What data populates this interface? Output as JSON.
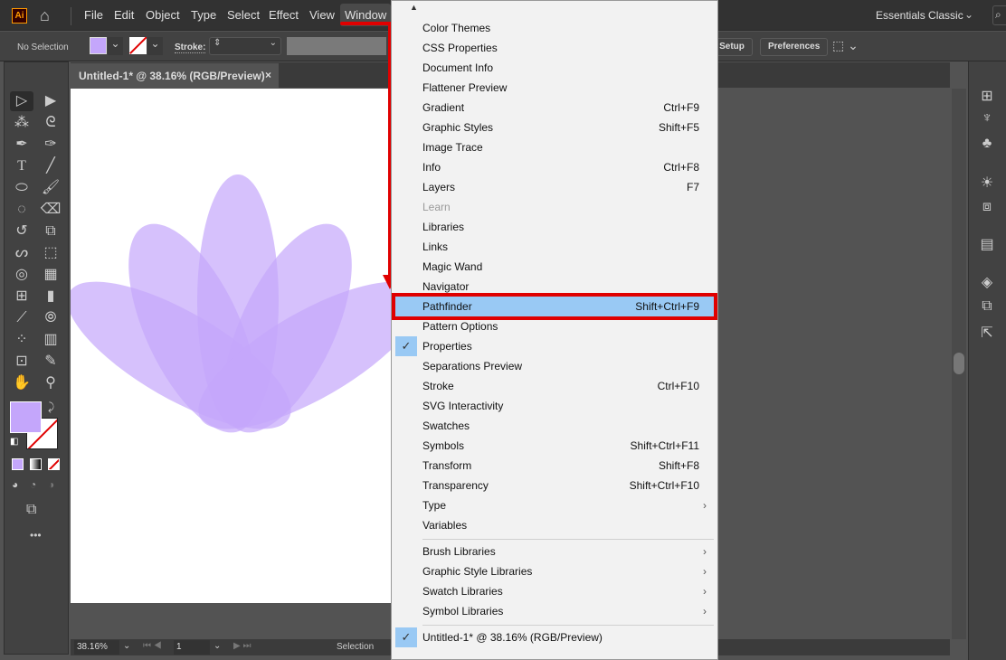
{
  "app": {
    "logo": "Ai",
    "menus": [
      "File",
      "Edit",
      "Object",
      "Type",
      "Select",
      "Effect",
      "View",
      "Window"
    ],
    "workspace": "Essentials Classic"
  },
  "control": {
    "selection": "No Selection",
    "stroke_label": "Stroke:",
    "doc_setup": "t Setup",
    "preferences": "Preferences"
  },
  "doc": {
    "tab_title": "Untitled-1* @ 38.16% (RGB/Preview)",
    "close": "×"
  },
  "status": {
    "zoom": "38.16%",
    "artboard": "1",
    "tool": "Selection"
  },
  "colors": {
    "fill": "#c4a6fb",
    "accent_red": "#e00000",
    "highlight": "#99c9f4"
  },
  "window_menu": {
    "items": [
      {
        "label": "Color Themes"
      },
      {
        "label": "CSS Properties"
      },
      {
        "label": "Document Info"
      },
      {
        "label": "Flattener Preview"
      },
      {
        "label": "Gradient",
        "shortcut": "Ctrl+F9"
      },
      {
        "label": "Graphic Styles",
        "shortcut": "Shift+F5"
      },
      {
        "label": "Image Trace"
      },
      {
        "label": "Info",
        "shortcut": "Ctrl+F8"
      },
      {
        "label": "Layers",
        "shortcut": "F7"
      },
      {
        "label": "Learn",
        "disabled": true
      },
      {
        "label": "Libraries"
      },
      {
        "label": "Links"
      },
      {
        "label": "Magic Wand"
      },
      {
        "label": "Navigator"
      },
      {
        "label": "Pathfinder",
        "shortcut": "Shift+Ctrl+F9",
        "highlighted": true
      },
      {
        "label": "Pattern Options"
      },
      {
        "label": "Properties",
        "checked": true
      },
      {
        "label": "Separations Preview"
      },
      {
        "label": "Stroke",
        "shortcut": "Ctrl+F10"
      },
      {
        "label": "SVG Interactivity"
      },
      {
        "label": "Swatches"
      },
      {
        "label": "Symbols",
        "shortcut": "Shift+Ctrl+F11"
      },
      {
        "label": "Transform",
        "shortcut": "Shift+F8"
      },
      {
        "label": "Transparency",
        "shortcut": "Shift+Ctrl+F10"
      },
      {
        "label": "Type",
        "submenu": true
      },
      {
        "label": "Variables"
      }
    ],
    "libraries": [
      {
        "label": "Brush Libraries"
      },
      {
        "label": "Graphic Style Libraries"
      },
      {
        "label": "Swatch Libraries"
      },
      {
        "label": "Symbol Libraries"
      }
    ],
    "documents": [
      {
        "label": "Untitled-1* @ 38.16% (RGB/Preview)",
        "checked": true
      }
    ]
  }
}
